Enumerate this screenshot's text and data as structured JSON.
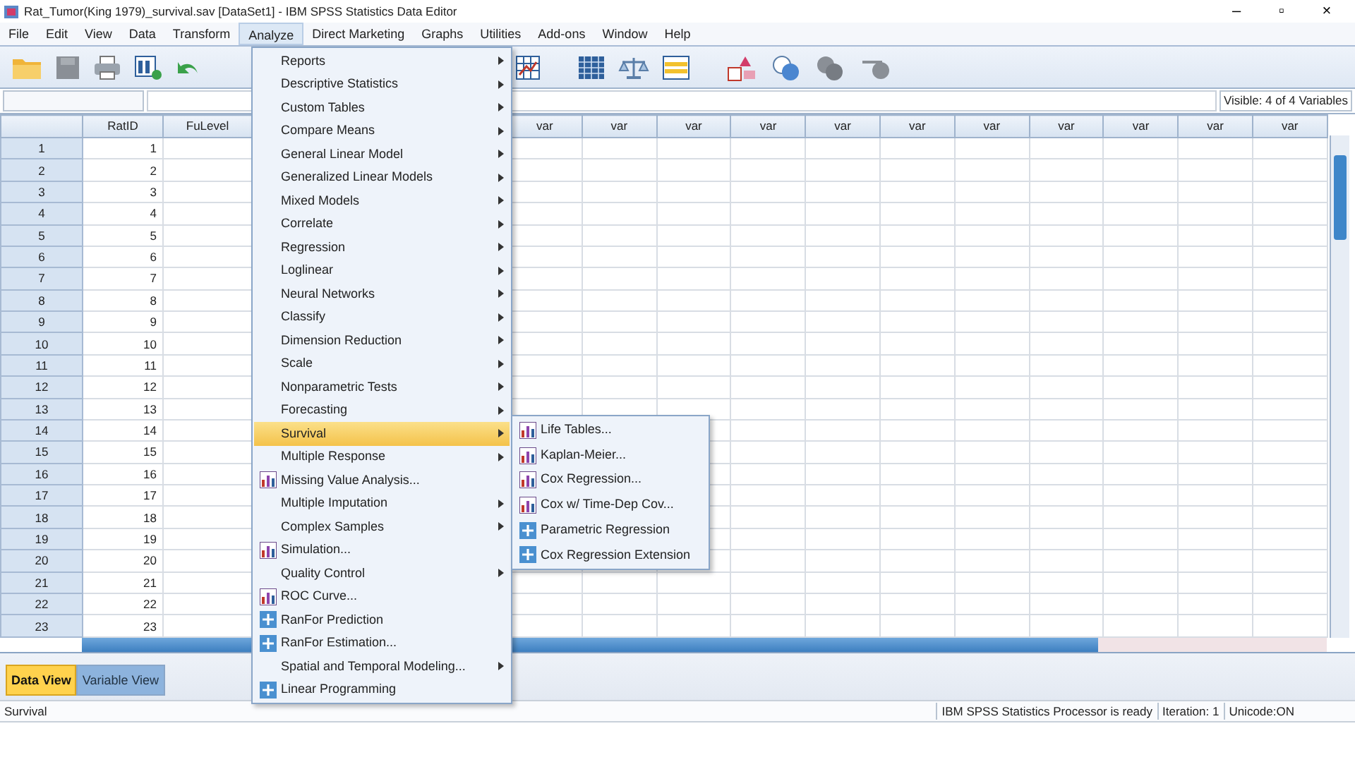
{
  "window": {
    "title": "Rat_Tumor(King 1979)_survival.sav [DataSet1] - IBM SPSS Statistics Data Editor",
    "controls": [
      "–",
      "▫",
      "×"
    ]
  },
  "menubar": [
    {
      "label": "File",
      "selected": false
    },
    {
      "label": "Edit",
      "selected": false
    },
    {
      "label": "View",
      "selected": false
    },
    {
      "label": "Data",
      "selected": false
    },
    {
      "label": "Transform",
      "selected": false
    },
    {
      "label": "Analyze",
      "selected": true
    },
    {
      "label": "Direct Marketing",
      "selected": false
    },
    {
      "label": "Graphs",
      "selected": false
    },
    {
      "label": "Utilities",
      "selected": false
    },
    {
      "label": "Add-ons",
      "selected": false
    },
    {
      "label": "Window",
      "selected": false
    },
    {
      "label": "Help",
      "selected": false
    }
  ],
  "visible_variables": "Visible: 4 of 4 Variables",
  "grid": {
    "columns": [
      "RatID",
      "FuLevel"
    ],
    "empty_columns": [
      "var",
      "var",
      "var",
      "var",
      "var",
      "var",
      "var",
      "var",
      "var",
      "var",
      "var"
    ],
    "rows": [
      {
        "row": "1",
        "rat_id": "1"
      },
      {
        "row": "2",
        "rat_id": "2"
      },
      {
        "row": "3",
        "rat_id": "3"
      },
      {
        "row": "4",
        "rat_id": "4"
      },
      {
        "row": "5",
        "rat_id": "5"
      },
      {
        "row": "6",
        "rat_id": "6"
      },
      {
        "row": "7",
        "rat_id": "7"
      },
      {
        "row": "8",
        "rat_id": "8"
      },
      {
        "row": "9",
        "rat_id": "9"
      },
      {
        "row": "10",
        "rat_id": "10"
      },
      {
        "row": "11",
        "rat_id": "11"
      },
      {
        "row": "12",
        "rat_id": "12"
      },
      {
        "row": "13",
        "rat_id": "13"
      },
      {
        "row": "14",
        "rat_id": "14"
      },
      {
        "row": "15",
        "rat_id": "15"
      },
      {
        "row": "16",
        "rat_id": "16"
      },
      {
        "row": "17",
        "rat_id": "17"
      },
      {
        "row": "18",
        "rat_id": "18"
      },
      {
        "row": "19",
        "rat_id": "19"
      },
      {
        "row": "20",
        "rat_id": "20"
      },
      {
        "row": "21",
        "rat_id": "21"
      },
      {
        "row": "22",
        "rat_id": "22"
      },
      {
        "row": "23",
        "rat_id": "23"
      }
    ]
  },
  "analyze_menu": [
    {
      "label": "Reports",
      "kind": "submenu",
      "selected": false
    },
    {
      "label": "Descriptive Statistics",
      "kind": "submenu",
      "selected": false
    },
    {
      "label": "Custom Tables",
      "kind": "submenu",
      "selected": false
    },
    {
      "label": "Compare Means",
      "kind": "submenu",
      "selected": false
    },
    {
      "label": "General Linear Model",
      "kind": "submenu",
      "selected": false
    },
    {
      "label": "Generalized Linear Models",
      "kind": "submenu",
      "selected": false
    },
    {
      "label": "Mixed Models",
      "kind": "submenu",
      "selected": false
    },
    {
      "label": "Correlate",
      "kind": "submenu",
      "selected": false
    },
    {
      "label": "Regression",
      "kind": "submenu",
      "selected": false
    },
    {
      "label": "Loglinear",
      "kind": "submenu",
      "selected": false
    },
    {
      "label": "Neural Networks",
      "kind": "submenu",
      "selected": false
    },
    {
      "label": "Classify",
      "kind": "submenu",
      "selected": false
    },
    {
      "label": "Dimension Reduction",
      "kind": "submenu",
      "selected": false
    },
    {
      "label": "Scale",
      "kind": "submenu",
      "selected": false
    },
    {
      "label": "Nonparametric Tests",
      "kind": "submenu",
      "selected": false
    },
    {
      "label": "Forecasting",
      "kind": "submenu",
      "selected": false
    },
    {
      "label": "Survival",
      "kind": "submenu",
      "selected": true
    },
    {
      "label": "Multiple Response",
      "kind": "submenu",
      "selected": false
    },
    {
      "label": "Missing Value Analysis...",
      "kind": "chart",
      "selected": false
    },
    {
      "label": "Multiple Imputation",
      "kind": "submenu",
      "selected": false
    },
    {
      "label": "Complex Samples",
      "kind": "submenu",
      "selected": false
    },
    {
      "label": "Simulation...",
      "kind": "chart",
      "selected": false
    },
    {
      "label": "Quality Control",
      "kind": "submenu",
      "selected": false
    },
    {
      "label": "ROC Curve...",
      "kind": "chart",
      "selected": false
    },
    {
      "label": "RanFor Prediction",
      "kind": "plus",
      "selected": false
    },
    {
      "label": "RanFor Estimation...",
      "kind": "plus",
      "selected": false
    },
    {
      "label": "Spatial and Temporal Modeling...",
      "kind": "submenu",
      "selected": false
    },
    {
      "label": "Linear Programming",
      "kind": "plus",
      "selected": false
    }
  ],
  "survival_menu": [
    {
      "label": "Life Tables...",
      "kind": "chart"
    },
    {
      "label": "Kaplan-Meier...",
      "kind": "chart"
    },
    {
      "label": "Cox Regression...",
      "kind": "chart"
    },
    {
      "label": "Cox w/ Time-Dep Cov...",
      "kind": "chart"
    },
    {
      "label": "Parametric Regression",
      "kind": "plus"
    },
    {
      "label": "Cox Regression Extension",
      "kind": "plus"
    }
  ],
  "view_tabs": [
    {
      "label": "Data View",
      "selected": true
    },
    {
      "label": "Variable View",
      "selected": false
    }
  ],
  "status_bar": [
    "Survival",
    "IBM SPSS Statistics Processor is ready",
    "Iteration: 1",
    "Unicode:ON"
  ]
}
